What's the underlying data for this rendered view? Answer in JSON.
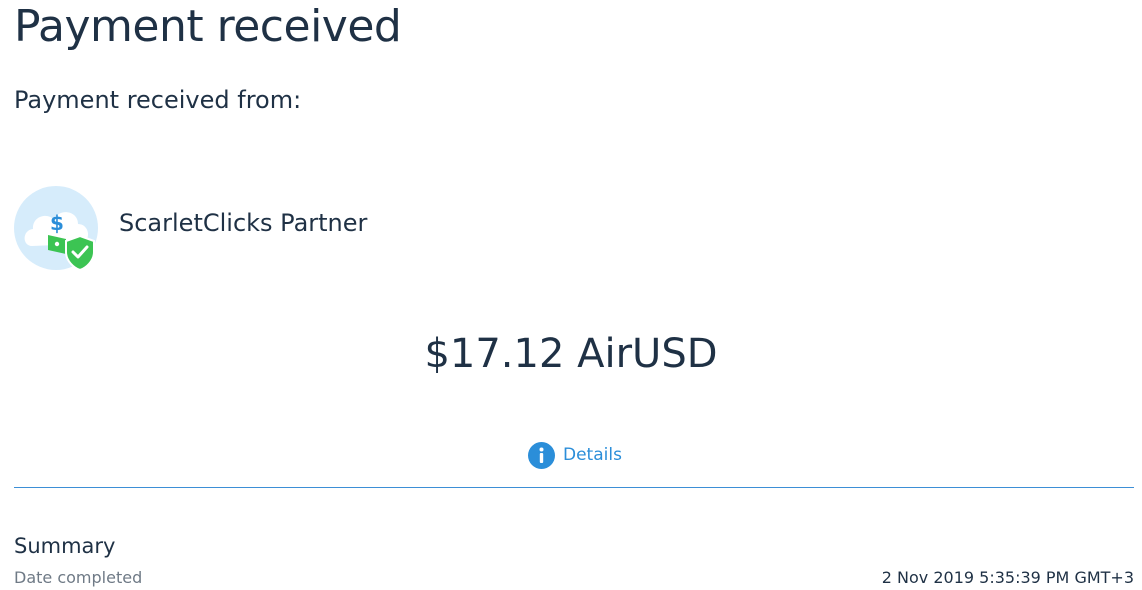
{
  "page": {
    "title": "Payment received"
  },
  "payment": {
    "from_label": "Payment received from:",
    "sender_name": "ScarletClicks Partner",
    "sender_avatar_icon": "money-shield-cloud-icon",
    "amount": "$17.12 AirUSD"
  },
  "details": {
    "label": "Details",
    "icon": "info-icon"
  },
  "summary": {
    "heading": "Summary",
    "rows": [
      {
        "label": "Date completed",
        "value": "2 Nov 2019 5:35:39 PM GMT+3"
      }
    ]
  },
  "colors": {
    "text_primary": "#1f3145",
    "text_secondary": "#6f7a86",
    "accent_blue": "#2b8ed9",
    "avatar_bg": "#d6ecfb",
    "avatar_cloud": "#ffffff",
    "money_green": "#3cc453",
    "dollar_blue": "#2b8ed9"
  }
}
